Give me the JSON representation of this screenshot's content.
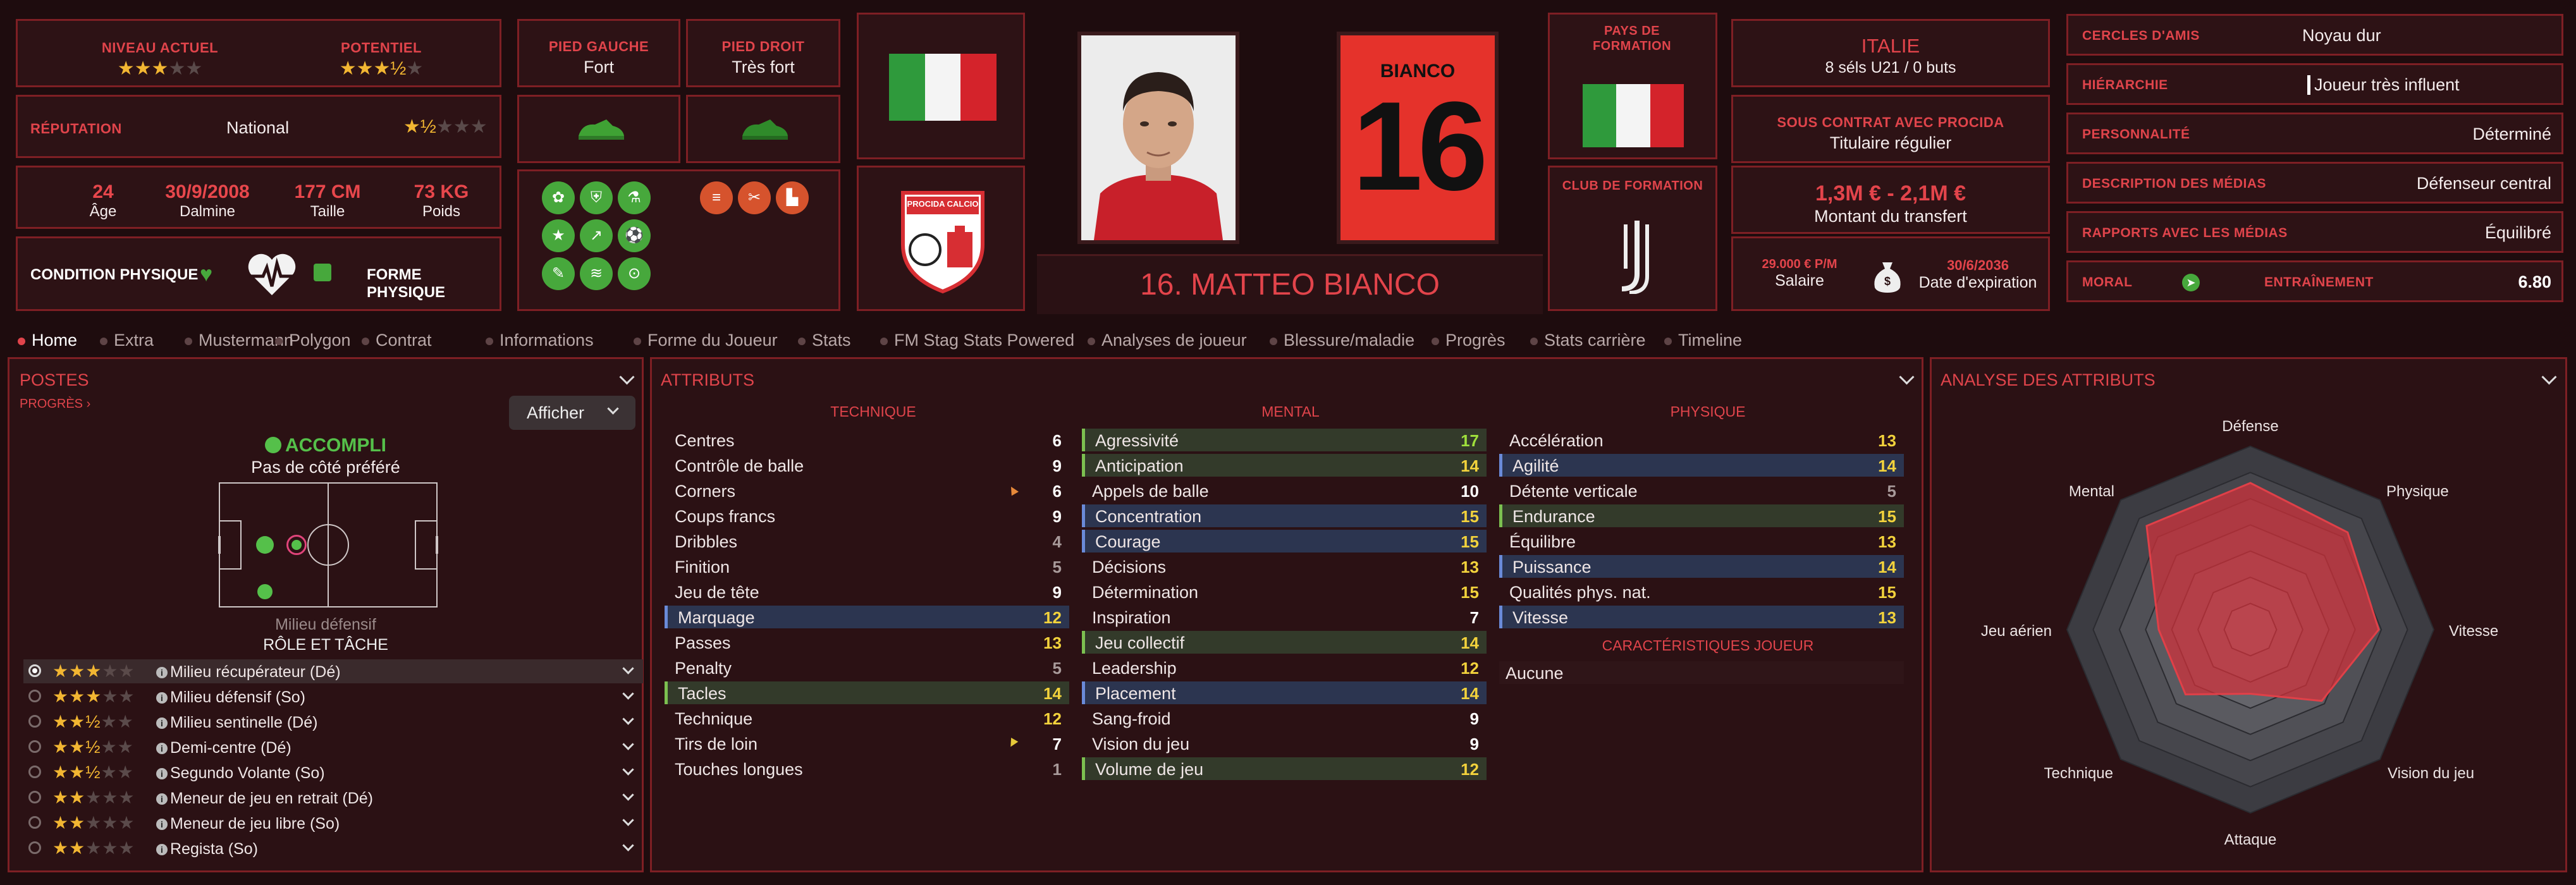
{
  "header": {
    "current_level_label": "NIVEAU ACTUEL",
    "current_level_stars": "★★★",
    "current_level_stars_off": "★★",
    "potential_label": "POTENTIEL",
    "potential_stars": "★★★½",
    "potential_stars_off": "★",
    "reputation_label": "RÉPUTATION",
    "reputation_value": "National",
    "reputation_stars": "★½",
    "reputation_stars_off": "★★★",
    "age_value": "24",
    "age_label": "Âge",
    "dob_value": "30/9/2008",
    "dob_label": "Dalmine",
    "height_value": "177 CM",
    "height_label": "Taille",
    "weight_value": "73 KG",
    "weight_label": "Poids",
    "condition_label": "CONDITION PHYSIQUE",
    "form_label": "FORME PHYSIQUE",
    "left_foot_label": "PIED GAUCHE",
    "left_foot_value": "Fort",
    "right_foot_label": "PIED DROIT",
    "right_foot_value": "Très fort",
    "club_crest_text": "PROCIDA CALCIO",
    "shirt_name": "BIANCO",
    "shirt_number": "16",
    "player_title": "16. MATTEO BIANCO",
    "formation_country_label": "PAYS DE FORMATION",
    "formation_club_label": "CLUB DE FORMATION",
    "nation_name": "ITALIE",
    "nation_caps": "8 séls U21 / 0 buts",
    "contract_label": "SOUS CONTRAT AVEC PROCIDA",
    "contract_value": "Titulaire régulier",
    "transfer_value": "1,3M € - 2,1M €",
    "transfer_label": "Montant du transfert",
    "salary_value": "29.000 € P/M",
    "salary_label": "Salaire",
    "expiry_value": "30/6/2036",
    "expiry_label": "Date d'expiration"
  },
  "info_rows": [
    {
      "label": "CERCLES D'AMIS",
      "value": "Noyau dur"
    },
    {
      "label": "HIÉRARCHIE",
      "value": "Joueur très influent"
    },
    {
      "label": "PERSONNALITÉ",
      "value": "Déterminé"
    },
    {
      "label": "DESCRIPTION DES MÉDIAS",
      "value": "Défenseur central"
    },
    {
      "label": "RAPPORTS AVEC LES MÉDIAS",
      "value": "Équilibré"
    }
  ],
  "morale": {
    "label": "MORAL",
    "training_label": "ENTRAÎNEMENT",
    "training_value": "6.80"
  },
  "tabs": [
    "Home",
    "Extra",
    "Mustermann",
    "Polygon",
    "Contrat",
    "Informations",
    "Forme du Joueur",
    "Stats",
    "FM Stag Stats Powered",
    "Analyses de joueur",
    "Blessure/maladie",
    "Progrès",
    "Stats carrière",
    "Timeline"
  ],
  "positions": {
    "title": "POSTES",
    "progress_link": "PROGRÈS",
    "show_button": "Afficher",
    "status": "ACCOMPLI",
    "side": "Pas de côté préféré",
    "position_name": "Milieu défensif",
    "role_label": "RÔLE ET TÂCHE",
    "roles": [
      {
        "name": "Milieu récupérateur (Dé)",
        "stars": "★★★",
        "off": "★★"
      },
      {
        "name": "Milieu défensif (So)",
        "stars": "★★★",
        "off": "★★"
      },
      {
        "name": "Milieu sentinelle (Dé)",
        "stars": "★★½",
        "off": "★★"
      },
      {
        "name": "Demi-centre (Dé)",
        "stars": "★★½",
        "off": "★★"
      },
      {
        "name": "Segundo Volante (So)",
        "stars": "★★½",
        "off": "★★"
      },
      {
        "name": "Meneur de jeu en retrait (Dé)",
        "stars": "★★",
        "off": "★★★"
      },
      {
        "name": "Meneur de jeu libre (So)",
        "stars": "★★",
        "off": "★★★"
      },
      {
        "name": "Regista (So)",
        "stars": "★★",
        "off": "★★★"
      }
    ]
  },
  "attributes": {
    "title": "ATTRIBUTS",
    "technique_label": "TECHNIQUE",
    "mental_label": "MENTAL",
    "physical_label": "PHYSIQUE",
    "traits_label": "CARACTÉRISTIQUES JOUEUR",
    "traits_value": "Aucune",
    "technique": [
      {
        "name": "Centres",
        "value": "6"
      },
      {
        "name": "Contrôle de balle",
        "value": "9"
      },
      {
        "name": "Corners",
        "value": "6"
      },
      {
        "name": "Coups francs",
        "value": "9"
      },
      {
        "name": "Dribbles",
        "value": "4"
      },
      {
        "name": "Finition",
        "value": "5"
      },
      {
        "name": "Jeu de tête",
        "value": "9"
      },
      {
        "name": "Marquage",
        "value": "12"
      },
      {
        "name": "Passes",
        "value": "13"
      },
      {
        "name": "Penalty",
        "value": "5"
      },
      {
        "name": "Tacles",
        "value": "14"
      },
      {
        "name": "Technique",
        "value": "12"
      },
      {
        "name": "Tirs de loin",
        "value": "7"
      },
      {
        "name": "Touches longues",
        "value": "1"
      }
    ],
    "mental": [
      {
        "name": "Agressivité",
        "value": "17"
      },
      {
        "name": "Anticipation",
        "value": "14"
      },
      {
        "name": "Appels de balle",
        "value": "10"
      },
      {
        "name": "Concentration",
        "value": "15"
      },
      {
        "name": "Courage",
        "value": "15"
      },
      {
        "name": "Décisions",
        "value": "13"
      },
      {
        "name": "Détermination",
        "value": "15"
      },
      {
        "name": "Inspiration",
        "value": "7"
      },
      {
        "name": "Jeu collectif",
        "value": "14"
      },
      {
        "name": "Leadership",
        "value": "12"
      },
      {
        "name": "Placement",
        "value": "14"
      },
      {
        "name": "Sang-froid",
        "value": "9"
      },
      {
        "name": "Vision du jeu",
        "value": "9"
      },
      {
        "name": "Volume de jeu",
        "value": "12"
      }
    ],
    "physical": [
      {
        "name": "Accélération",
        "value": "13"
      },
      {
        "name": "Agilité",
        "value": "14"
      },
      {
        "name": "Détente verticale",
        "value": "5"
      },
      {
        "name": "Endurance",
        "value": "15"
      },
      {
        "name": "Équilibre",
        "value": "13"
      },
      {
        "name": "Puissance",
        "value": "14"
      },
      {
        "name": "Qualités phys. nat.",
        "value": "15"
      },
      {
        "name": "Vitesse",
        "value": "13"
      }
    ]
  },
  "analysis": {
    "title": "ANALYSE DES ATTRIBUTS",
    "axes": [
      "Défense",
      "Physique",
      "Vitesse",
      "Vision du jeu",
      "Attaque",
      "Technique",
      "Jeu aérien",
      "Mental"
    ],
    "fractions": [
      0.8,
      0.75,
      0.7,
      0.55,
      0.35,
      0.5,
      0.5,
      0.8
    ]
  },
  "colors": {
    "accent": "#e0444b",
    "border": "#7e1f24",
    "panel": "#2b1114",
    "green": "#47a83c",
    "gold": "#f2b632"
  }
}
